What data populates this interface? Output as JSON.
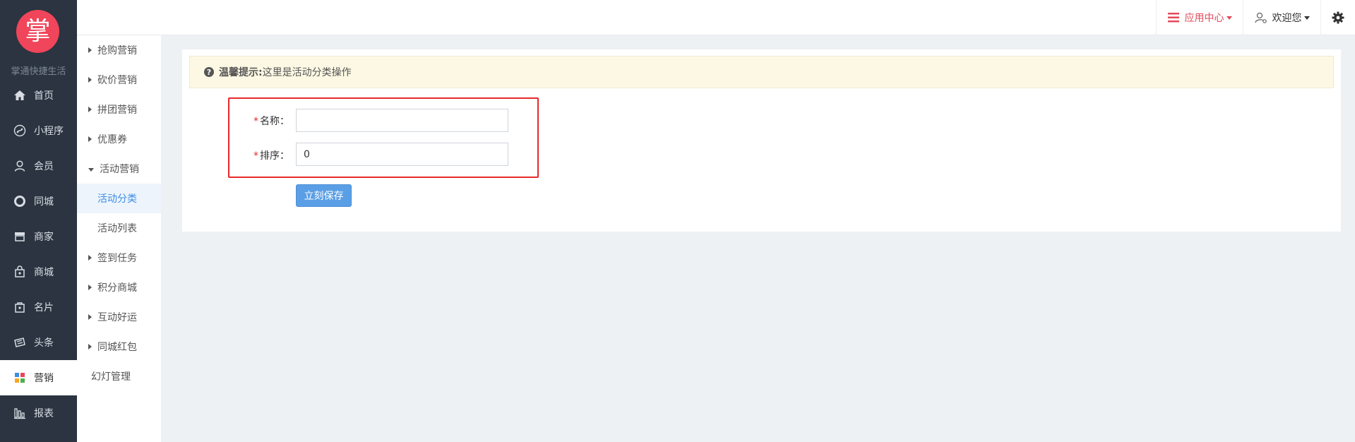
{
  "brand": {
    "logo_char": "掌",
    "name": "掌通快捷生活",
    "logo_color": "#f0455a"
  },
  "leftnav": {
    "items": [
      {
        "label": "首页",
        "icon": "home-icon"
      },
      {
        "label": "小程序",
        "icon": "mini-program-icon"
      },
      {
        "label": "会员",
        "icon": "user-icon"
      },
      {
        "label": "同城",
        "icon": "circle-icon"
      },
      {
        "label": "商家",
        "icon": "store-icon"
      },
      {
        "label": "商城",
        "icon": "shopping-bag-icon"
      },
      {
        "label": "名片",
        "icon": "card-icon"
      },
      {
        "label": "头条",
        "icon": "news-icon"
      },
      {
        "label": "营销",
        "icon": "marketing-icon"
      },
      {
        "label": "报表",
        "icon": "chart-icon"
      }
    ],
    "active_label": "营销"
  },
  "submenu": {
    "items": [
      {
        "label": "抢购营销"
      },
      {
        "label": "砍价营销"
      },
      {
        "label": "拼团营销"
      },
      {
        "label": "优惠券"
      },
      {
        "label": "活动营销"
      }
    ],
    "children": [
      {
        "label": "活动分类"
      },
      {
        "label": "活动列表"
      }
    ],
    "items_after": [
      {
        "label": "签到任务"
      },
      {
        "label": "积分商城"
      },
      {
        "label": "互动好运"
      },
      {
        "label": "同城红包"
      }
    ],
    "plain": "幻灯管理"
  },
  "topbar": {
    "app_center": "应用中心",
    "welcome": "欢迎您",
    "accent_color": "#e34a5b"
  },
  "tip": {
    "label": "温馨提示:",
    "text": "这里是活动分类操作"
  },
  "form": {
    "name_label": "名称：",
    "name_value": "",
    "sort_label": "排序：",
    "sort_value": "0",
    "required_mark": "*",
    "save_label": "立刻保存"
  }
}
